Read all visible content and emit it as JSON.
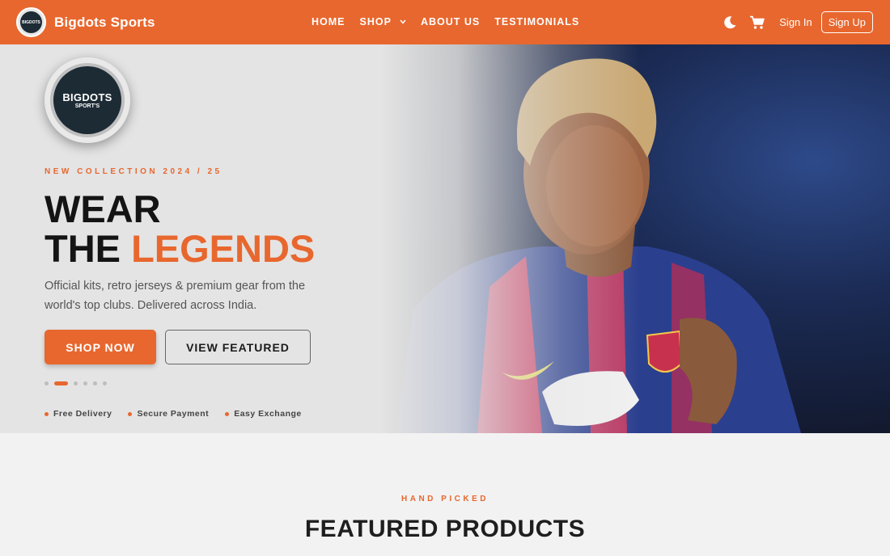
{
  "nav": {
    "brand": "Bigdots Sports",
    "logo_text": "BIGDOTS",
    "menu": [
      {
        "label": "HOME"
      },
      {
        "label": "SHOP",
        "has_dropdown": true
      },
      {
        "label": "ABOUT US"
      },
      {
        "label": "TESTIMONIALS"
      }
    ],
    "theme_icon": "moon-icon",
    "cart_icon": "cart-icon",
    "signin_label": "Sign In",
    "signup_label": "Sign Up"
  },
  "hero": {
    "logo_big": "BIGDOTS",
    "logo_small": "SPORT'S",
    "eyebrow": "NEW COLLECTION 2024 / 25",
    "headline_line1": "WEAR",
    "headline_line2_a": "THE ",
    "headline_line2_b": "LEGENDS",
    "description": "Official kits, retro jerseys & premium gear from the world's top clubs. Delivered across India.",
    "primary_cta": "SHOP NOW",
    "secondary_cta": "VIEW FEATURED",
    "carousel": {
      "total": 6,
      "active_index": 1
    },
    "features": [
      "Free Delivery",
      "Secure Payment",
      "Easy Exchange"
    ]
  },
  "featured": {
    "eyebrow": "HAND PICKED",
    "title": "FEATURED PRODUCTS"
  },
  "colors": {
    "accent": "#e8672e",
    "hero_bg": "#e4e4e4",
    "page_bg": "#f2f2f2",
    "headline": "#141414"
  }
}
